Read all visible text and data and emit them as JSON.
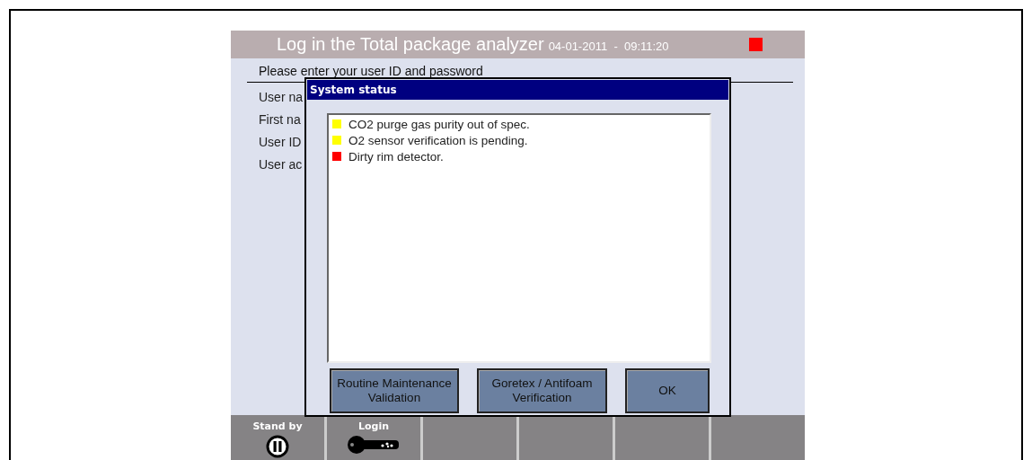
{
  "window": {
    "title": "Log in the Total package analyzer",
    "datetime": "04-01-2011  -  09:11:20",
    "alarm": true
  },
  "login": {
    "instruction": "Please enter your user ID and password",
    "fields": [
      {
        "label": "User na"
      },
      {
        "label": "First na"
      },
      {
        "label": "User ID"
      },
      {
        "label": "User ac"
      }
    ]
  },
  "dialog": {
    "title": "System status",
    "messages": [
      {
        "text": "CO2 purge gas purity out of spec.",
        "color": "#ffff00"
      },
      {
        "text": "O2 sensor verification is pending.",
        "color": "#ffff00"
      },
      {
        "text": "Dirty rim detector.",
        "color": "#ff0000"
      }
    ],
    "buttons": [
      "Routine Maintenance\nValidation",
      "Goretex / Antifoam\nVerification",
      "OK"
    ]
  },
  "function_keys": [
    {
      "kind": "pause",
      "label": "Stand by"
    },
    {
      "kind": "key",
      "label": "Login"
    },
    {
      "kind": "empty"
    },
    {
      "kind": "empty"
    },
    {
      "kind": "empty"
    },
    {
      "kind": "empty"
    }
  ]
}
